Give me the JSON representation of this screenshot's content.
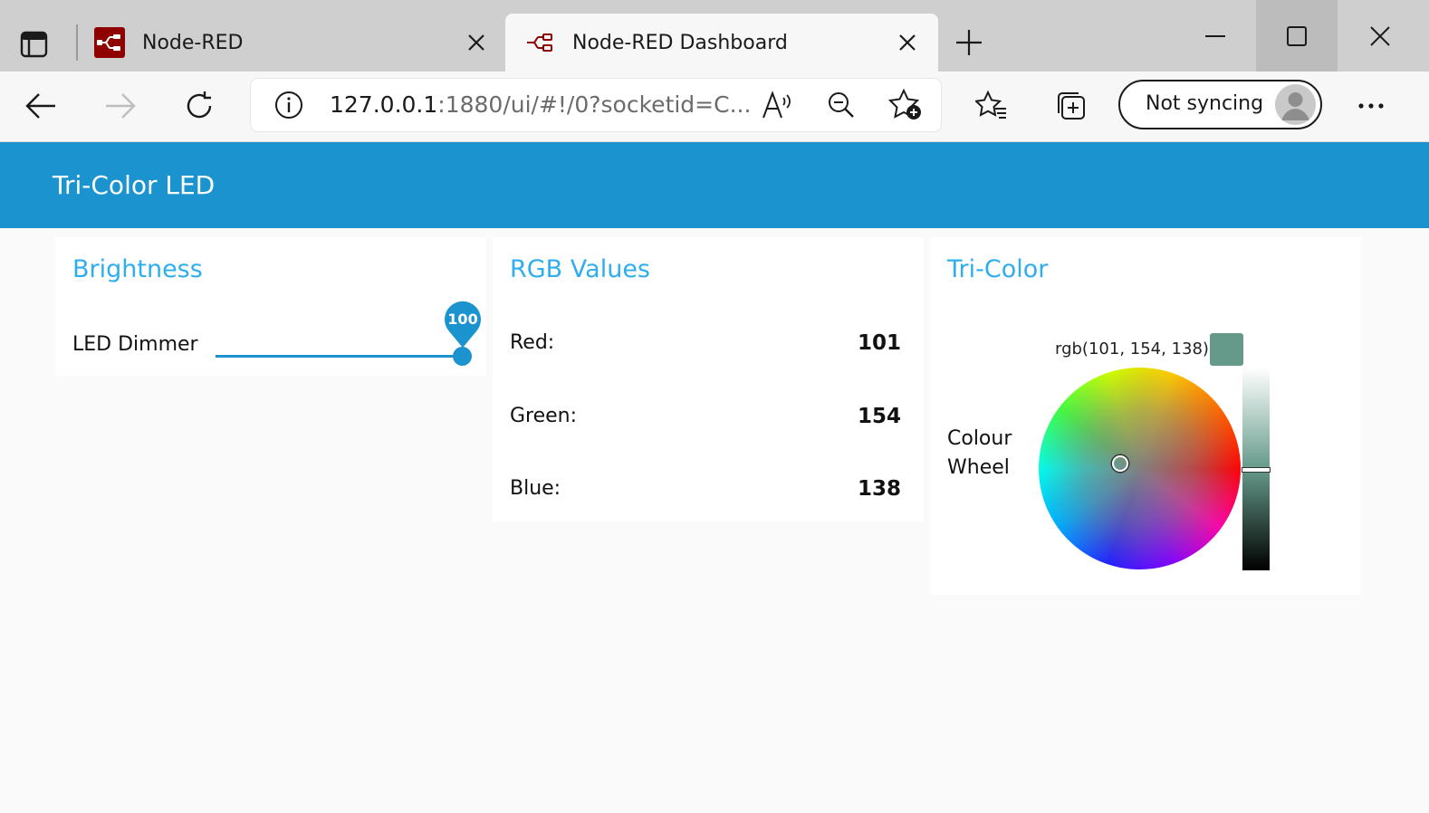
{
  "browser": {
    "tabs": [
      {
        "title": "Node-RED"
      },
      {
        "title": "Node-RED Dashboard"
      }
    ],
    "address": {
      "host": "127.0.0.1",
      "path": ":1880/ui/#!/0?socketid=C..."
    },
    "sync_label": "Not syncing"
  },
  "dashboard": {
    "title": "Tri-Color LED",
    "brightness": {
      "title": "Brightness",
      "label": "LED Dimmer",
      "value": "100",
      "level": 1.0
    },
    "rgb": {
      "title": "RGB Values",
      "rows": [
        {
          "label": "Red:",
          "value": "101"
        },
        {
          "label": "Green:",
          "value": "154"
        },
        {
          "label": "Blue:",
          "value": "138"
        }
      ]
    },
    "tricolor": {
      "title": "Tri-Color",
      "label_line1": "Colour",
      "label_line2": "Wheel",
      "readout": "rgb(101, 154, 138)",
      "swatch_color": "#659a8a"
    }
  },
  "colors": {
    "accent": "#1a93cf",
    "title_blue": "#2eaeef"
  }
}
